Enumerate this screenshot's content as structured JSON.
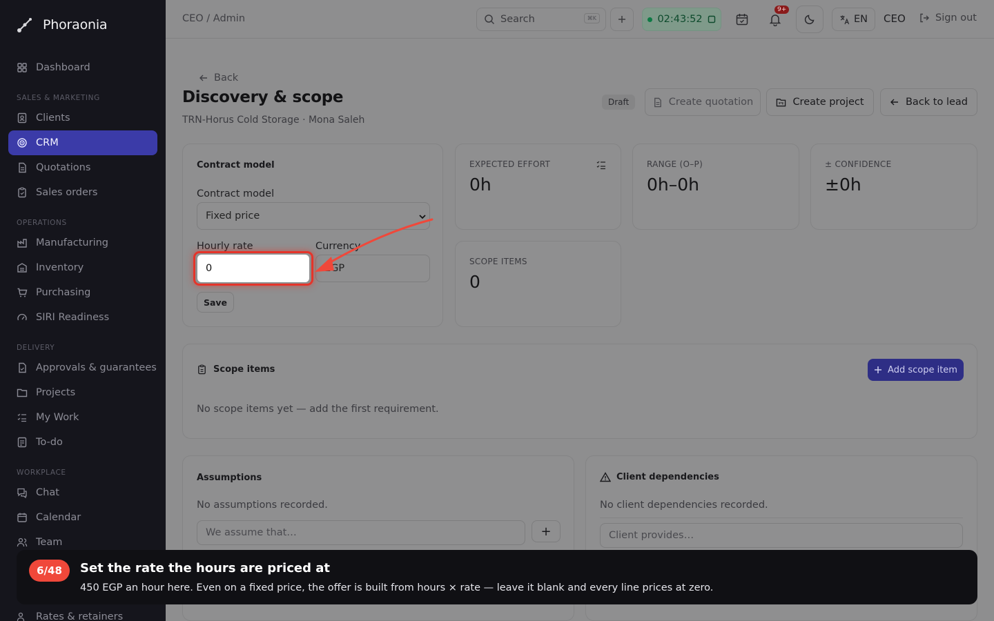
{
  "app": {
    "name": "Phoraonia"
  },
  "sidebar": {
    "items": [
      {
        "label": "Dashboard"
      },
      {
        "label": "Clients"
      },
      {
        "label": "CRM"
      },
      {
        "label": "Quotations"
      },
      {
        "label": "Sales orders"
      },
      {
        "label": "Manufacturing"
      },
      {
        "label": "Inventory"
      },
      {
        "label": "Purchasing"
      },
      {
        "label": "SIRI Readiness"
      },
      {
        "label": "Approvals & guarantees"
      },
      {
        "label": "Projects"
      },
      {
        "label": "My Work"
      },
      {
        "label": "To-do"
      },
      {
        "label": "Chat"
      },
      {
        "label": "Calendar"
      },
      {
        "label": "Team"
      },
      {
        "label": "Rates & retainers"
      }
    ],
    "sections": [
      "SALES & MARKETING",
      "OPERATIONS",
      "DELIVERY",
      "WORKPLACE"
    ],
    "active": "CRM",
    "active_color": "#3b3ba8"
  },
  "topbar": {
    "breadcrumb": "CEO / Admin",
    "search_placeholder": "Search",
    "search_shortcut": "⌘K",
    "timer": "02:43:52",
    "notification_badge": "9+",
    "language": "EN",
    "role": "CEO",
    "signout": "Sign out"
  },
  "page": {
    "back_label": "Back",
    "title": "Discovery & scope",
    "subtitle": "TRN-Horus Cold Storage · Mona Saleh",
    "status": "Draft",
    "actions": {
      "create_quotation": "Create quotation",
      "create_project": "Create project",
      "back_to_lead": "Back to lead"
    }
  },
  "contract": {
    "card_title": "Contract model",
    "model_label": "Contract model",
    "model_value": "Fixed price",
    "rate_label": "Hourly rate",
    "rate_value": "0",
    "currency_label": "Currency",
    "currency_value": "EGP",
    "save_label": "Save"
  },
  "stats": {
    "expected_effort": {
      "label": "EXPECTED EFFORT",
      "value": "0h"
    },
    "range": {
      "label": "RANGE (O–P)",
      "value": "0h–0h"
    },
    "confidence": {
      "label": "± CONFIDENCE",
      "value": "±0h"
    },
    "scope_items": {
      "label": "SCOPE ITEMS",
      "value": "0"
    }
  },
  "scope": {
    "title": "Scope items",
    "add_label": "Add scope item",
    "empty": "No scope items yet — add the first requirement."
  },
  "assumptions": {
    "title": "Assumptions",
    "empty": "No assumptions recorded.",
    "placeholder": "We assume that…",
    "add_symbol": "+"
  },
  "dependencies": {
    "title": "Client dependencies",
    "empty": "No client dependencies recorded.",
    "placeholder": "Client provides…"
  },
  "tour": {
    "step": "6/48",
    "title": "Set the rate the hours are priced at",
    "body": "450 EGP an hour here. Even on a fixed price, the offer is built from hours × rate — leave it blank and every line prices at zero."
  },
  "colors": {
    "highlight": "#e5342a",
    "tour_pill": "#f0483a",
    "primary": "#2e2e85"
  }
}
